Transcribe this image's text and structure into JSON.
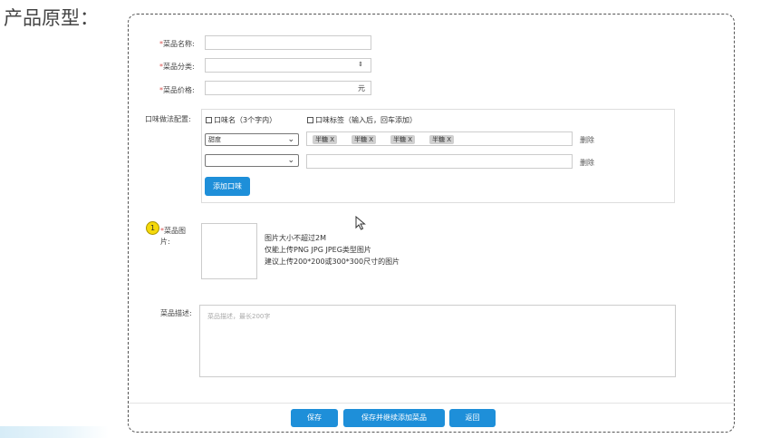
{
  "page_heading": "产品原型：",
  "form": {
    "name": {
      "required": "*",
      "label": "菜品名称:",
      "value": ""
    },
    "category": {
      "required": "*",
      "label": "菜品分类:",
      "value": "",
      "arrow": "⇕"
    },
    "price": {
      "required": "*",
      "label": "菜品价格:",
      "value": "",
      "suffix": "元"
    },
    "flavor": {
      "label": "口味做法配置:",
      "col_name_header": "口味名（3个字内）",
      "col_tags_header": "口味标签（输入后，回车添加）",
      "rows": [
        {
          "select": "甜度",
          "tags": [
            "半糖 X",
            "半糖 X",
            "半糖 X",
            "半糖 X"
          ],
          "delete": "删除"
        },
        {
          "select": "",
          "tags": [],
          "delete": "删除"
        }
      ],
      "add_button": "添加口味"
    },
    "image": {
      "badge": "1",
      "required": "*",
      "label_line1": "菜品图",
      "label_line2": "片:",
      "hints": [
        "图片大小不超过2M",
        "仅能上传PNG JPG JPEG类型图片",
        "建议上传200*200或300*300尺寸的图片"
      ]
    },
    "description": {
      "label": "菜品描述:",
      "placeholder": "菜品描述，最长200字"
    }
  },
  "buttons": {
    "save": "保存",
    "save_continue": "保存并继续添加菜品",
    "back": "返回"
  },
  "colors": {
    "primary": "#1e8fd9",
    "required": "#d9534f",
    "badge": "#f5d90a"
  }
}
